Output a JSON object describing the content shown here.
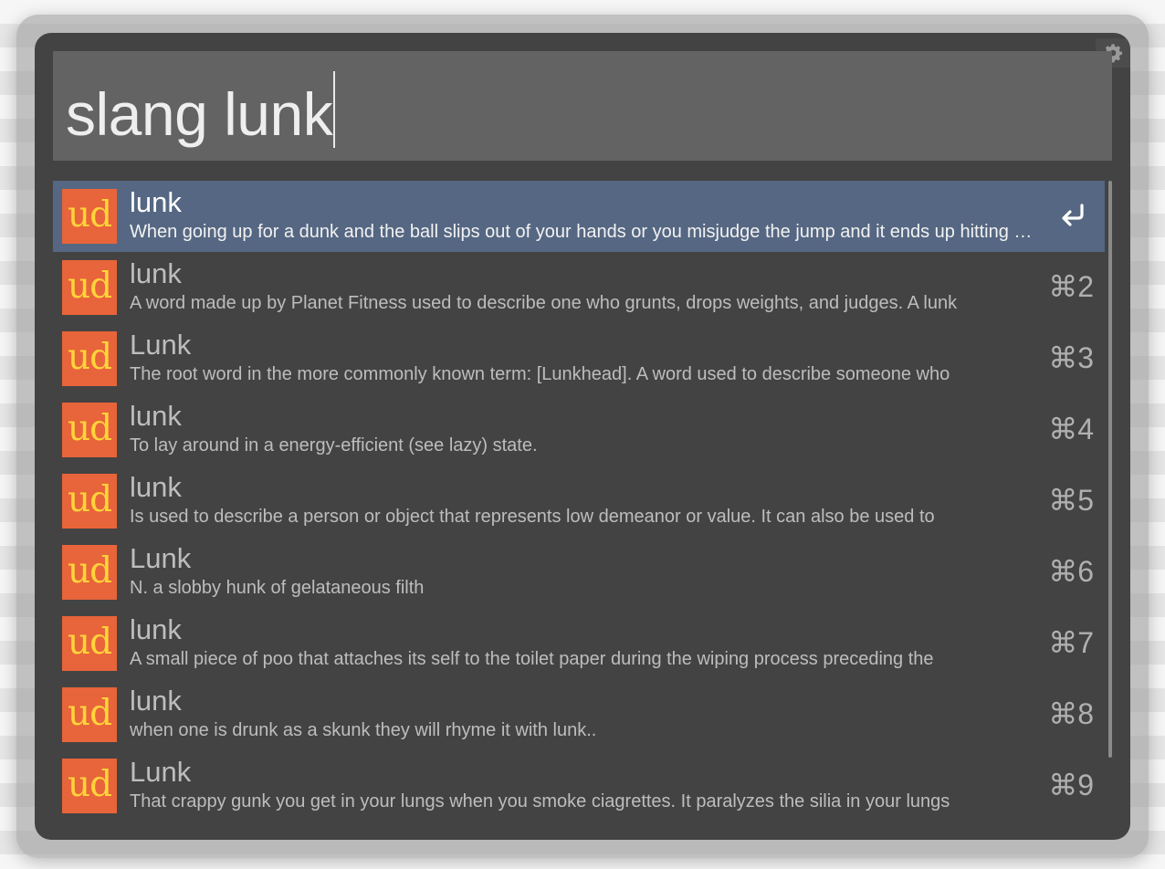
{
  "search": {
    "query": "slang lunk"
  },
  "results": [
    {
      "title": "lunk",
      "subtitle": "When going up for a dunk and the ball slips out of your hands or you misjudge the jump and it ends up hitting the rim",
      "shortcut": "",
      "icon_text": "ud",
      "selected": true
    },
    {
      "title": "lunk",
      "subtitle": "A word made up by Planet Fitness used to describe one who grunts, drops weights, and judges. A lunk",
      "shortcut": "⌘2",
      "icon_text": "ud"
    },
    {
      "title": "Lunk",
      "subtitle": "The root word in the more commonly known term: [Lunkhead].  A word used to describe someone who",
      "shortcut": "⌘3",
      "icon_text": "ud"
    },
    {
      "title": "lunk",
      "subtitle": "To lay around in a energy-efficient (see lazy) state.",
      "shortcut": "⌘4",
      "icon_text": "ud"
    },
    {
      "title": "lunk",
      "subtitle": "Is used to describe a person or object that represents low demeanor or value. It can also be used to",
      "shortcut": "⌘5",
      "icon_text": "ud"
    },
    {
      "title": "Lunk",
      "subtitle": "N. a slobby hunk of gelataneous filth",
      "shortcut": "⌘6",
      "icon_text": "ud"
    },
    {
      "title": "lunk",
      "subtitle": "A small piece of poo that attaches its self to the toilet paper during the wiping process preceding the",
      "shortcut": "⌘7",
      "icon_text": "ud"
    },
    {
      "title": "lunk",
      "subtitle": "when one is drunk as a skunk they will rhyme it with lunk..",
      "shortcut": "⌘8",
      "icon_text": "ud"
    },
    {
      "title": "Lunk",
      "subtitle": "That crappy gunk you get in your lungs when you smoke ciagrettes. It paralyzes the silia in your lungs",
      "shortcut": "⌘9",
      "icon_text": "ud"
    }
  ],
  "selected_action_icon": "return-arrow-icon",
  "settings_icon": "gear-icon",
  "colors": {
    "window_bg": "#434343",
    "search_bg": "#636363",
    "selected_row_bg": "#556782",
    "icon_bg": "#e8643a",
    "icon_text": "#ffd43a"
  }
}
